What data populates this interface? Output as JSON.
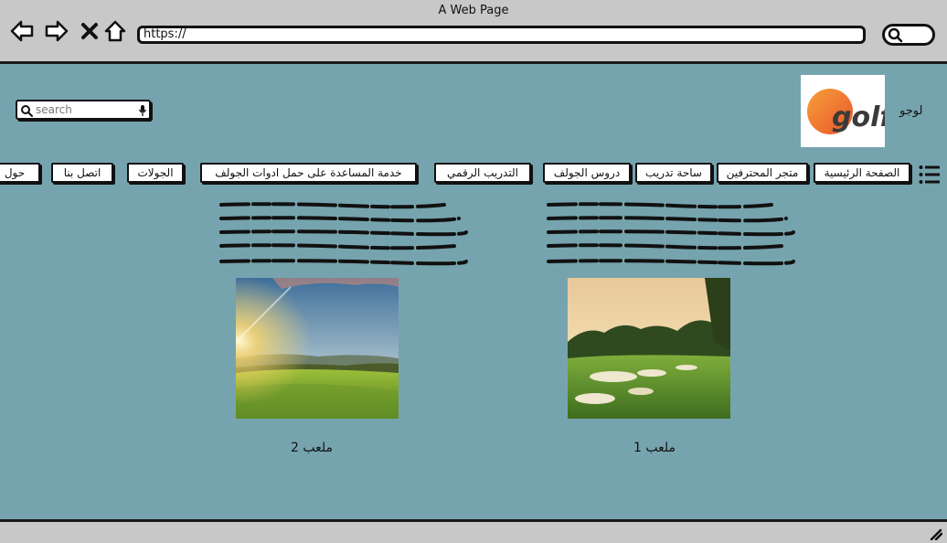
{
  "window": {
    "title": "A Web Page"
  },
  "address_bar": {
    "url": "https://"
  },
  "header": {
    "search_placeholder": "search",
    "logo_label": "لوجو",
    "logo_text": "golf"
  },
  "nav": {
    "items": [
      {
        "label": "الصفحة الرئيسية"
      },
      {
        "label": "متجر المحترفين"
      },
      {
        "label": "ساحة تدريب"
      },
      {
        "label": "دروس الجولف"
      },
      {
        "label": "التدريب الرقمي"
      },
      {
        "label": "خدمة المساعدة على حمل ادوات الجولف"
      },
      {
        "label": "الجولات"
      },
      {
        "label": "اتصل بنا"
      },
      {
        "label": "حول"
      }
    ]
  },
  "courses": [
    {
      "caption": "ملعب 1"
    },
    {
      "caption": "ملعب 2"
    }
  ],
  "colors": {
    "page_bg": "#76a4ae",
    "chrome_bg": "#c8c8c8",
    "logo_orange": "#f07a2a"
  }
}
